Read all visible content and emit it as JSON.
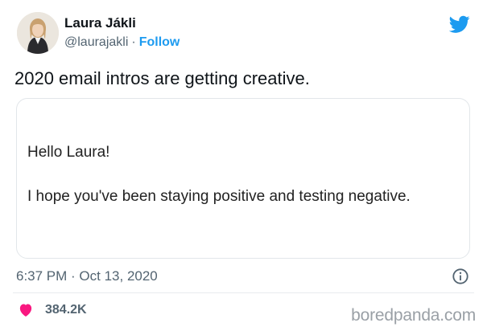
{
  "user": {
    "name": "Laura Jákli",
    "handle": "@laurajakli",
    "separator": "·",
    "follow_label": "Follow"
  },
  "tweet": {
    "text": "2020 email intros are getting creative."
  },
  "email_card": {
    "greeting": "Hello Laura!",
    "body": "I hope you've been staying positive and testing negative."
  },
  "meta": {
    "timestamp": "6:37 PM · Oct 13, 2020"
  },
  "engagement": {
    "likes": "384.2K"
  },
  "watermark": "boredpanda.com",
  "icons": {
    "logo": "twitter-bird-icon",
    "info": "info-icon",
    "like": "heart-icon"
  },
  "colors": {
    "accent": "#1d9bf0",
    "like": "#f91880",
    "text": "#0f1419",
    "muted": "#536471"
  }
}
